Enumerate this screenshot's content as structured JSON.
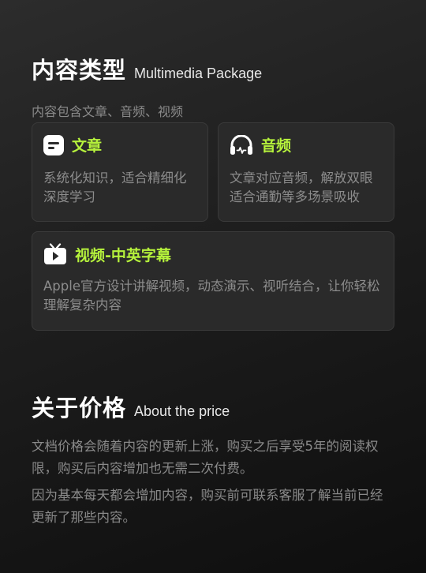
{
  "content_type": {
    "title_cn": "内容类型",
    "title_en": "Multimedia Package",
    "subtitle": "内容包含文章、音频、视频"
  },
  "cards": {
    "article": {
      "label": "文章",
      "desc": "系统化知识，适合精细化深度学习",
      "icon": "article-icon"
    },
    "audio": {
      "label": "音频",
      "desc": "文章对应音频，解放双眼适合通勤等多场景吸收",
      "icon": "headphones-icon"
    },
    "video": {
      "label": "视频-中英字幕",
      "desc": "Apple官方设计讲解视频，动态演示、视听结合，让你轻松理解复杂内容",
      "icon": "tv-icon"
    }
  },
  "price": {
    "title_cn": "关于价格",
    "title_en": "About the price",
    "para1": "文档价格会随着内容的更新上涨，购买之后享受5年的阅读权限，购买后内容增加也无需二次付费。",
    "para2": "因为基本每天都会增加内容，购买前可联系客服了解当前已经更新了那些内容。"
  },
  "colors": {
    "accent": "#b6f23c",
    "text_muted": "#8a8a8a",
    "card_bg": "#2a2a2a"
  }
}
